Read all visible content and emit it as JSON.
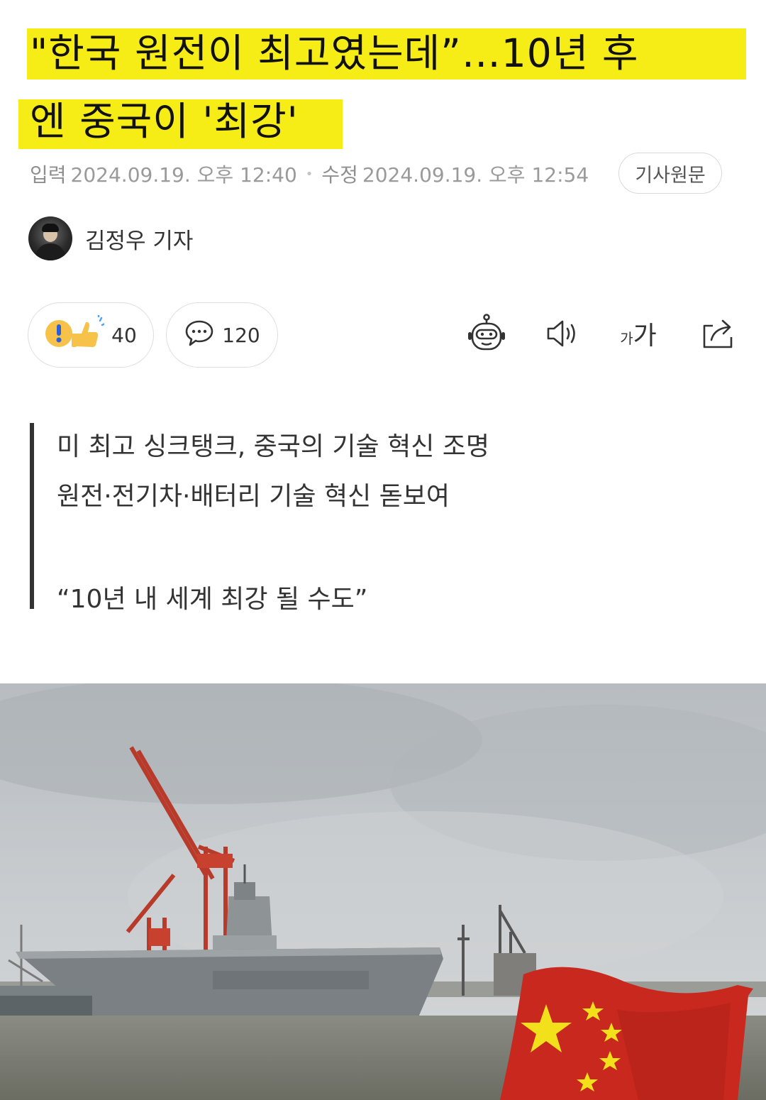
{
  "headline": {
    "line1": "\"한국 원전이 최고였는데”…10년 후",
    "line2": "엔 중국이 '최강'",
    "highlight_color": "#f6ec16"
  },
  "meta": {
    "input_label": "입력",
    "input_time": "2024.09.19. 오후 12:40",
    "edit_label": "수정",
    "edit_time": "2024.09.19. 오후 12:54",
    "original_button": "기사원문"
  },
  "author": {
    "name": "김정우 기자"
  },
  "reactions": {
    "reaction_icon": "surprised-thumbs-up-icon",
    "reaction_count": "40",
    "comment_icon": "speech-bubble-icon",
    "comment_count": "120"
  },
  "toolbar": {
    "icons": [
      "robot-summary-icon",
      "speaker-icon",
      "font-size-icon",
      "share-icon"
    ],
    "font_size_label_small": "가",
    "font_size_label_large": "가"
  },
  "summary": {
    "lines": [
      "미 최고 싱크탱크, 중국의 기술 혁신 조명",
      "원전·전기차·배터리 기술 혁신 돋보여",
      "“10년 내 세계 최강 될 수도”"
    ]
  },
  "photo": {
    "subject": "aircraft carrier docked at shipyard with cranes and Chinese flag",
    "flag_color": "#c8281e",
    "star_color": "#f2e01a"
  }
}
